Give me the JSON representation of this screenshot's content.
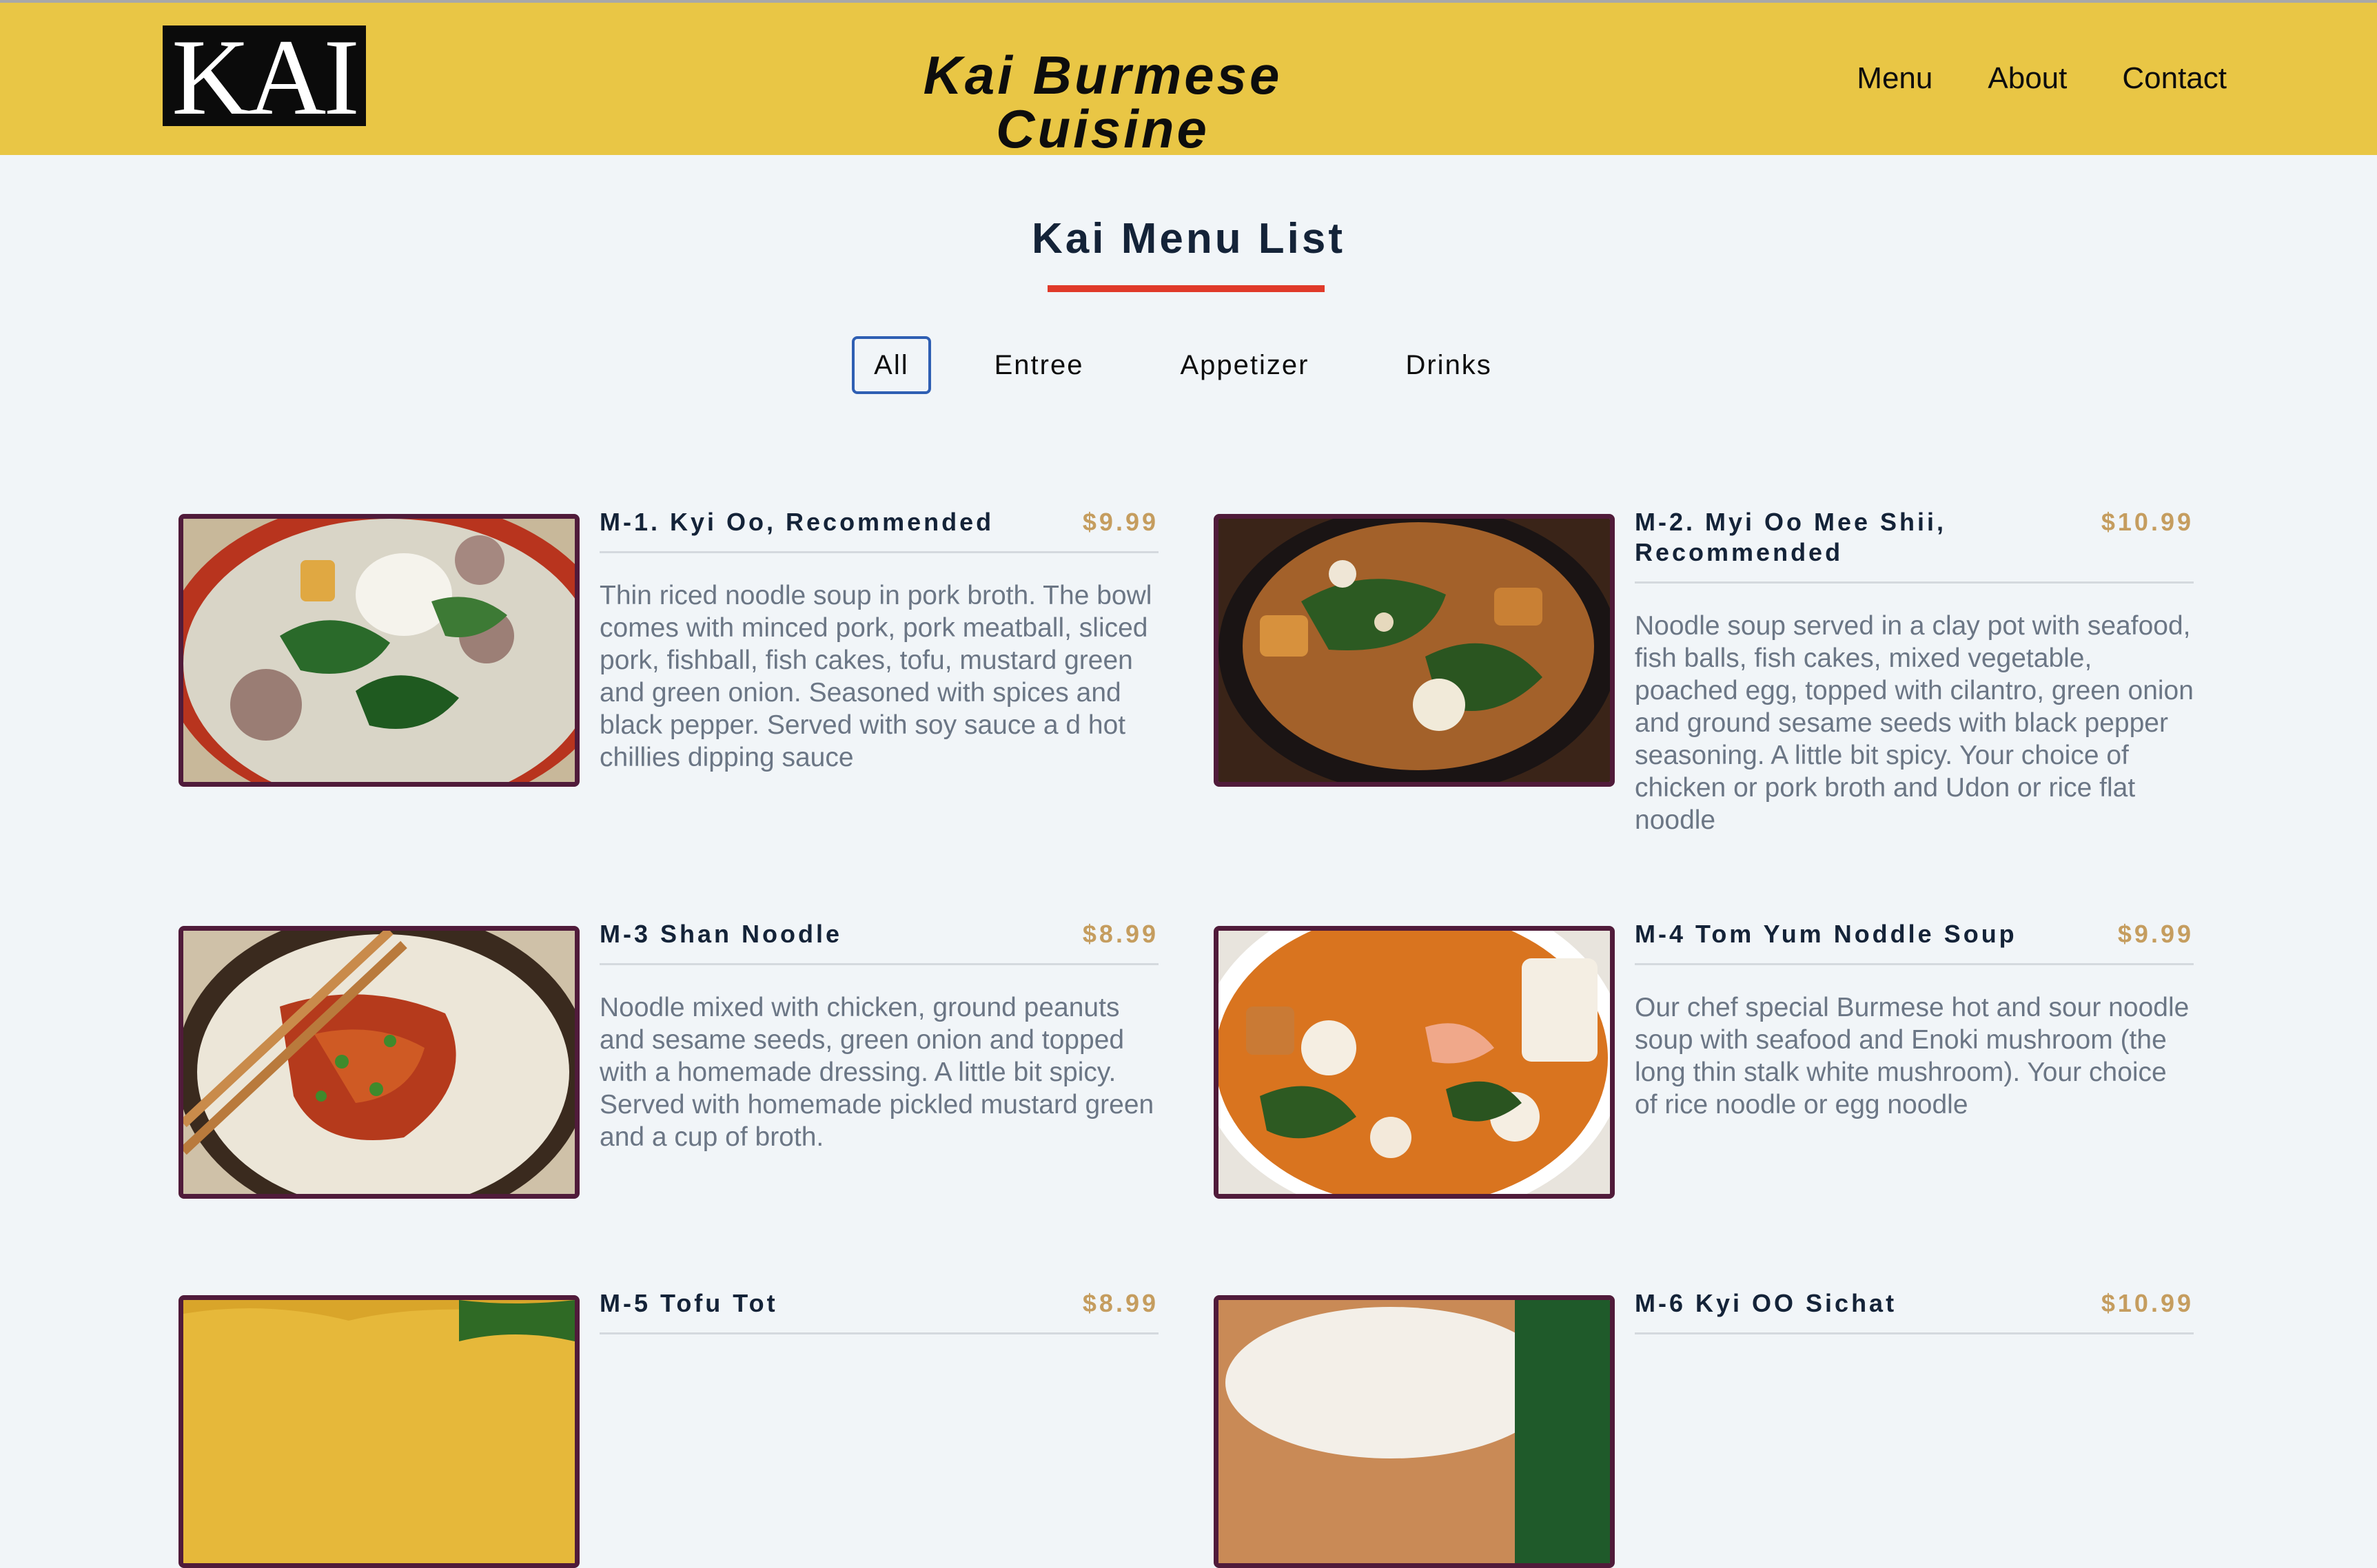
{
  "header": {
    "logo_text": "KAI",
    "site_title": "Kai Burmese Cuisine",
    "nav": [
      "Menu",
      "About",
      "Contact"
    ]
  },
  "menu_section": {
    "title": "Kai Menu List",
    "accent_color": "#e03a2a",
    "filters": [
      {
        "label": "All",
        "active": true
      },
      {
        "label": "Entree",
        "active": false
      },
      {
        "label": "Appetizer",
        "active": false
      },
      {
        "label": "Drinks",
        "active": false
      }
    ]
  },
  "items": [
    {
      "name": "M-1. Kyi Oo, Recommended",
      "price": "$9.99",
      "description": "Thin riced noodle soup in pork broth. The bowl comes with minced pork, pork meatball, sliced pork, fishball, fish cakes, tofu, mustard green and green onion. Seasoned with spices and black pepper. Served with soy sauce a d hot chillies dipping sauce",
      "photo": "kyi-oo-photo"
    },
    {
      "name": "M-2. Myi Oo Mee Shii, Recommended",
      "price": "$10.99",
      "description": "Noodle soup served in a clay pot with seafood, fish balls, fish cakes, mixed vegetable, poached egg, topped with cilantro, green onion and ground sesame seeds with black pepper seasoning. A little bit spicy. Your choice of chicken or pork broth and Udon or rice flat noodle",
      "photo": "myi-oo-mee-shii-photo"
    },
    {
      "name": "M-3 Shan Noodle",
      "price": "$8.99",
      "description": "Noodle mixed with chicken, ground peanuts and sesame seeds, green onion and topped with a homemade dressing. A little bit spicy. Served with homemade pickled mustard green and a cup of broth.",
      "photo": "shan-noodle-photo"
    },
    {
      "name": "M-4 Tom Yum Noddle Soup",
      "price": "$9.99",
      "description": "Our chef special Burmese hot and sour noodle soup with seafood and Enoki mushroom (the long thin stalk white mushroom). Your choice of rice noodle or egg noodle",
      "photo": "tom-yum-photo"
    },
    {
      "name": "M-5 Tofu Tot",
      "price": "$8.99",
      "description": "",
      "photo": "tofu-tot-photo"
    },
    {
      "name": "M-6 Kyi OO Sichat",
      "price": "$10.99",
      "description": "",
      "photo": "kyi-oo-sichat-photo"
    }
  ],
  "colors": {
    "header_bg": "#e9c645",
    "page_bg": "#f1f5f8",
    "price": "#c59d5f",
    "photo_border": "#501b3a",
    "active_filter_border": "#2f5fb3"
  }
}
